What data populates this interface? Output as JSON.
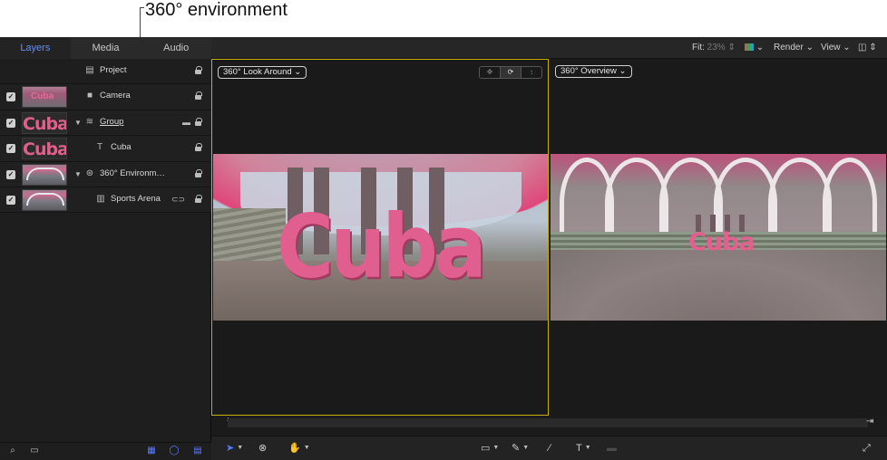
{
  "callout": {
    "label": "360° environment"
  },
  "panel": {
    "tabs": [
      {
        "label": "Layers",
        "active": true
      },
      {
        "label": "Media",
        "active": false
      },
      {
        "label": "Audio",
        "active": false
      }
    ],
    "layers": [
      {
        "name": "Project",
        "icon": "document-icon",
        "checked": false
      },
      {
        "name": "Camera",
        "icon": "camera-icon",
        "checked": true
      },
      {
        "name": "Group",
        "icon": "group-icon",
        "checked": true,
        "disclosure": "expanded"
      },
      {
        "name": "Cuba",
        "icon": "text-icon",
        "checked": true,
        "thumb_text": "Cuba"
      },
      {
        "name": "360° Environm…",
        "icon": "360-environment-icon",
        "checked": true,
        "disclosure": "expanded"
      },
      {
        "name": "Sports Arena",
        "icon": "film-icon",
        "checked": true,
        "link_icon": "link-icon"
      }
    ],
    "group_thumb_text": "Cuba",
    "camera_thumb_text": "Cuba"
  },
  "toolbar": {
    "fit_label": "Fit:",
    "fit_value": "23%",
    "render_label": "Render",
    "view_label": "View"
  },
  "viewers": {
    "left": {
      "popup": "360° Look Around",
      "scene_text": "Cuba"
    },
    "right": {
      "popup": "360° Overview",
      "scene_text": "Cuba"
    }
  },
  "colors": {
    "accent_blue": "#5f8fff",
    "viewer_border": "#c8b000",
    "cuba_pink": "#e05f8f"
  }
}
